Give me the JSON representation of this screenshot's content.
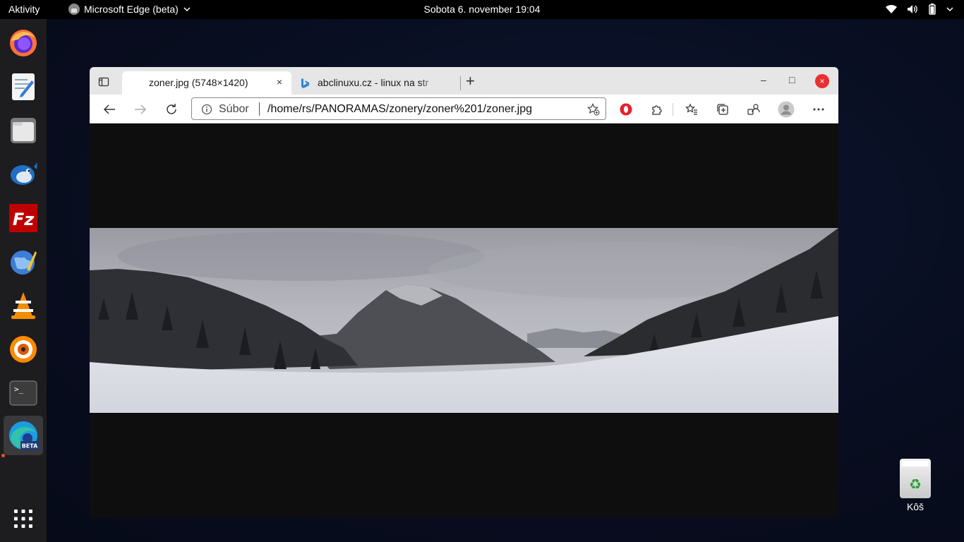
{
  "topbar": {
    "activities": "Aktivity",
    "app_name": "Microsoft Edge (beta)",
    "clock": "Sobota  6. november  19:04",
    "tray_icons": [
      "wifi-icon",
      "volume-icon",
      "battery-icon",
      "chevron-down-icon"
    ]
  },
  "dock": {
    "items": [
      {
        "name": "firefox",
        "icon": "firefox-icon"
      },
      {
        "name": "text-editor",
        "icon": "text-editor-icon"
      },
      {
        "name": "files",
        "icon": "files-icon"
      },
      {
        "name": "thunderbird",
        "icon": "thunderbird-icon"
      },
      {
        "name": "filezilla",
        "icon": "filezilla-icon",
        "text": "Fz"
      },
      {
        "name": "kompozer",
        "icon": "globe-icon"
      },
      {
        "name": "vlc",
        "icon": "vlc-icon"
      },
      {
        "name": "xnview",
        "icon": "xnview-icon"
      },
      {
        "name": "terminal",
        "icon": "terminal-icon",
        "text": ">_"
      },
      {
        "name": "edge-beta",
        "icon": "edge-beta-icon",
        "badge": "BETA",
        "active": true
      },
      {
        "name": "show-apps",
        "icon": "app-grid-icon"
      }
    ]
  },
  "browser": {
    "tabs": [
      {
        "title": "zoner.jpg (5748×1420)",
        "active": true
      },
      {
        "title": "abclinuxu.cz - linux na str",
        "active": false
      }
    ],
    "close_symbol": "×",
    "new_tab_symbol": "+",
    "window": {
      "minimize": "–",
      "maximize": "□",
      "close": "×"
    },
    "address": {
      "label": "Súbor",
      "url": "/home/rs/PANORAMAS/zonery/zoner%201/zoner.jpg"
    },
    "toolbar_icons": [
      "back-icon",
      "forward-icon",
      "refresh-icon",
      "opera-vpn-icon",
      "extensions-icon",
      "favorites-icon",
      "collections-icon",
      "profile-switch-icon",
      "avatar-icon",
      "more-icon"
    ],
    "image": {
      "alt": "zoner.jpg"
    }
  },
  "desktop": {
    "trash_label": "Kôš"
  },
  "colors": {
    "accent": "#e95420",
    "close_red": "#e8302f",
    "opera_red": "#e8202a"
  }
}
